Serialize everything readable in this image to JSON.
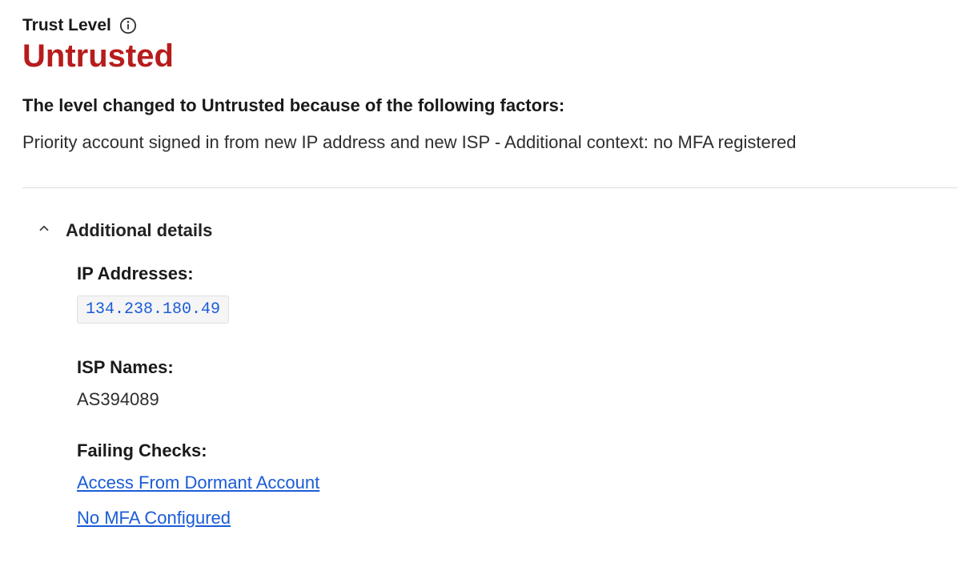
{
  "trust_level": {
    "label": "Trust Level",
    "value": "Untrusted"
  },
  "explanation": {
    "heading": "The level changed to Untrusted because of the following factors:",
    "text": "Priority account signed in from new IP address and new ISP - Additional context: no MFA registered"
  },
  "details": {
    "title": "Additional details",
    "ip_addresses": {
      "label": "IP Addresses:",
      "values": [
        "134.238.180.49"
      ]
    },
    "isp_names": {
      "label": "ISP Names:",
      "values": [
        "AS394089"
      ]
    },
    "failing_checks": {
      "label": "Failing Checks:",
      "values": [
        "Access From Dormant Account",
        "No MFA Configured"
      ]
    }
  }
}
